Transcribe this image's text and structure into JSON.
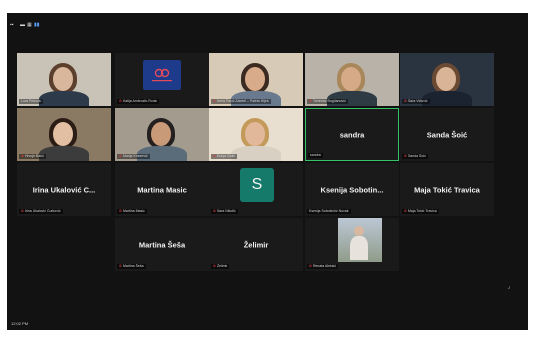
{
  "toolbar": {
    "icons": [
      "more-icon",
      "minimize-icon",
      "grid-view-icon",
      "speaker-view-icon"
    ],
    "glyphs": [
      "▪▪",
      "▬",
      "▦",
      "▮▮"
    ]
  },
  "accent_color": "#35c265",
  "mute_color": "#e13b3b",
  "participants": [
    {
      "row": 0,
      "col": 0,
      "label": "Lora Pekovic",
      "has_video": true,
      "muted": false
    },
    {
      "row": 0,
      "col": 1,
      "label": "Katija Ambrozik-Ronic",
      "has_video": false,
      "logo": true,
      "muted": true
    },
    {
      "row": 0,
      "col": 2,
      "label": "Irena Pavić Zaletel – Paleta Hljeb",
      "has_video": true,
      "muted": true
    },
    {
      "row": 0,
      "col": 3,
      "label": "Tomislav Bogdanović",
      "has_video": true,
      "muted": true
    },
    {
      "row": 0,
      "col": 4,
      "label": "Sara Vidović",
      "has_video": true,
      "muted": true
    },
    {
      "row": 1,
      "col": 0,
      "label": "Hrvoje Barić",
      "has_video": true,
      "muted": true
    },
    {
      "row": 1,
      "col": 1,
      "label": "Marija Knezević",
      "has_video": true,
      "muted": true
    },
    {
      "row": 1,
      "col": 2,
      "label": "Dunja Galić",
      "has_video": true,
      "muted": true
    },
    {
      "row": 1,
      "col": 3,
      "name": "sandra",
      "label": "sandra",
      "has_video": false,
      "active": true,
      "muted": false
    },
    {
      "row": 1,
      "col": 4,
      "name": "Sanda Šoić",
      "label": "Sanda Šoić",
      "has_video": false,
      "muted": true
    },
    {
      "row": 2,
      "col": 0,
      "name": "Irina Ukalović C...",
      "label": "Irina Ukalović Ćurković",
      "has_video": false,
      "muted": true
    },
    {
      "row": 2,
      "col": 1,
      "name": "Martina Masic",
      "label": "Martina Masic",
      "has_video": false,
      "muted": true
    },
    {
      "row": 2,
      "col": 2,
      "avatar": "S",
      "label": "Sara Nikolić",
      "has_video": false,
      "muted": true
    },
    {
      "row": 2,
      "col": 3,
      "name": "Ksenija Sobotin...",
      "label": "Ksenija Sobotinčić Novak",
      "has_video": false,
      "muted": false
    },
    {
      "row": 2,
      "col": 4,
      "name": "Maja Tokić Travica",
      "label": "Maja Tokić Travica",
      "has_video": false,
      "muted": true
    },
    {
      "row": 3,
      "col": 1,
      "name": "Martina Šeša",
      "label": "Martina Šeša",
      "has_video": false,
      "muted": true
    },
    {
      "row": 3,
      "col": 2,
      "name": "Želimir",
      "label": "Želimir",
      "has_video": false,
      "muted": true
    },
    {
      "row": 3,
      "col": 3,
      "label": "Renata Aleksić",
      "has_video": true,
      "photo": true,
      "muted": true
    }
  ],
  "status": {
    "label": "12:02 PM"
  }
}
